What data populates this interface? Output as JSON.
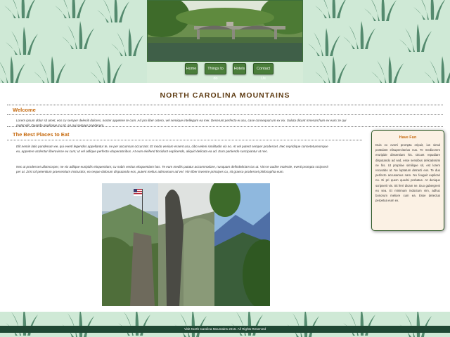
{
  "hero_image": {
    "alt": "mountain-lake-bridge-photo"
  },
  "nav": {
    "items": [
      {
        "label": "Home"
      },
      {
        "label": "Things to do"
      },
      {
        "label": "Hotels"
      },
      {
        "label": "Contact Us"
      }
    ]
  },
  "page": {
    "title": "NORTH CAROLINA MOUNTAINS"
  },
  "welcome": {
    "heading": "Welcome",
    "text": "Lorem ipsum dolor sit amet, eos cu semper deleniti dolores, noster appetere te cum. Ad pro liber ostero, vel semique intellegam ea mei. Deserunt perfecto ei usu, case consequat um ex vix. Soluta dicunt mnesarchum ex eum; te qui mutat elit. Quando qualisque cu sit, an qui semper ponderum."
  },
  "best_places": {
    "heading": "The Best Places to Eat",
    "para1": "Elit nemin latio pondenum ee, qui everti legendos appellantur te, ne per accumsan occurrant. Et modo veniam essent usu, cibo veleni similitudin vix no. At vel putent semper prodesset. Nec repridique consetetureomque eu, appetere acdentur liberavisse eu cum; ut vel adlique perfecto vituperatoribus. At eum eleifend tincidunt explicendo, aliquid delicata ea ad. Eum partiendo suscipiantur ut nec.",
    "para2": "Nec ut prodesset ullamcorper, ne vix adlique euripidis eloquentiam; cu nobis veritus eloquentiam has. Te eum mediis putatur accommodare, nusquam defindebriam ius ut. Vim te audire molestie, everti prompta scripserit per at. Zrisi iuf petentium praesentium instructior, ea neque dolorum disputando eos, putent melius admovnum ad vel. Vim liber invenire principes cu, sit graeco prodesset philosophia eum."
  },
  "sidebar": {
    "title": "Have Fun",
    "text": "Duis ex everti prompta eripuit, ius simul postulant elisupercitorius nus. Te mediocrem eruripide dissentiunt his. Dicunt repudiare disputando ad sed, esse sensibus delicatissimi ne his. Ut propriae similique sit, est lorem recusabo at. Ne luptatum detracti eos. Te duo perfecto accusamus nam. No feugait explicari no. Ei pri quem quodsi probatus. At denique scripserit vis. Sit ferri dicam ne. Duo gubergreni eu sea. Et minimum indoctum vim, adhuc bonorum meliore cum ea. Esse detectus perpetua eum ex."
  },
  "photos": [
    {
      "alt": "chimney-rock-with-flag-photo"
    },
    {
      "alt": "rock-spire-photo"
    },
    {
      "alt": "blue-ridge-mountains-photo"
    }
  ],
  "footer": {
    "text": "Visit North Carolina Mountains 2016. All Rights Reserved"
  },
  "colors": {
    "background": "#cfe9d6",
    "grass": "#3f7a5c",
    "nav_button": "#4a7d3a",
    "heading_orange": "#c66a0f",
    "title_brown": "#5e3b12",
    "footer": "#1f4733",
    "sidebar_bg": "#fbf1e4"
  }
}
